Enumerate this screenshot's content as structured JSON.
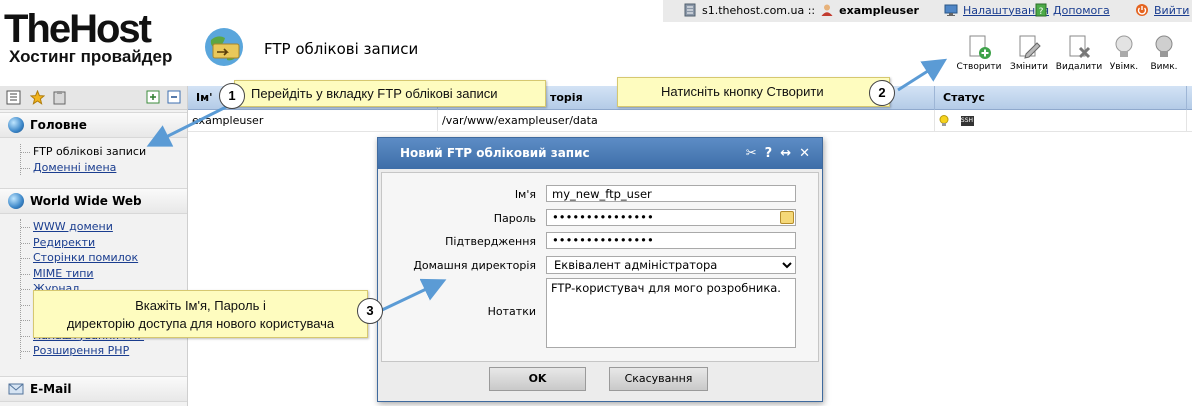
{
  "brand": {
    "name": "TheHost",
    "tagline": "Хостинг провайдер"
  },
  "page_title": "FTP облікові записи",
  "topbar": {
    "server": "s1.thehost.com.ua ::",
    "username": "exampleuser",
    "settings_label": "Налаштування",
    "help_label": "Допомога",
    "logout_label": "Вийти"
  },
  "toolbar": {
    "create": "Створити",
    "edit": "Змінити",
    "delete": "Видалити",
    "enable": "Увімк.",
    "disable": "Вимк."
  },
  "sidebar": {
    "sections": [
      {
        "title": "Головне",
        "items": [
          "FTP облікові записи",
          "Доменні імена"
        ]
      },
      {
        "title": "World Wide Web",
        "items": [
          "WWW домени",
          "Редиректи",
          "Сторінки помилок",
          "MIME типи",
          "Журнал",
          "",
          "",
          "Налаштування PHP",
          "Розширення PHP"
        ]
      },
      {
        "title": "E-Mail",
        "items": []
      }
    ]
  },
  "table": {
    "headers": [
      "Ім'я",
      "Домашня директорія",
      "Статус"
    ],
    "visible_headers": {
      "name": "Ім'",
      "dir": "торія",
      "status": "Статус"
    },
    "rows": [
      {
        "name": "exampleuser",
        "dir": "/var/www/exampleuser/data"
      }
    ]
  },
  "dialog": {
    "title": "Новий FTP обліковий запис",
    "labels": {
      "name": "Ім'я",
      "password": "Пароль",
      "confirm": "Підтвердження",
      "homedir": "Домашня директорія",
      "notes": "Нотатки"
    },
    "values": {
      "name": "my_new_ftp_user",
      "password": "•••••••••••••••",
      "confirm": "•••••••••••••••",
      "homedir": "Еквівалент адміністратора",
      "notes": "FTP-користувач для мого розробника."
    },
    "ok": "OK",
    "cancel": "Скасування"
  },
  "callouts": [
    {
      "step": "1",
      "text": "Перейдіть у вкладку FTP облікові записи"
    },
    {
      "step": "2",
      "text": "Натисніть кнопку Створити"
    },
    {
      "step": "3",
      "line1": "Вкажіть Ім'я, Пароль і",
      "line2": "директорію доступа для нового користувача"
    }
  ],
  "colors": {
    "header_blue": "#b4cbe7",
    "dialog_title": "#4a79b4",
    "callout_bg": "#fefcbf",
    "arrow": "#5b9bd5"
  }
}
